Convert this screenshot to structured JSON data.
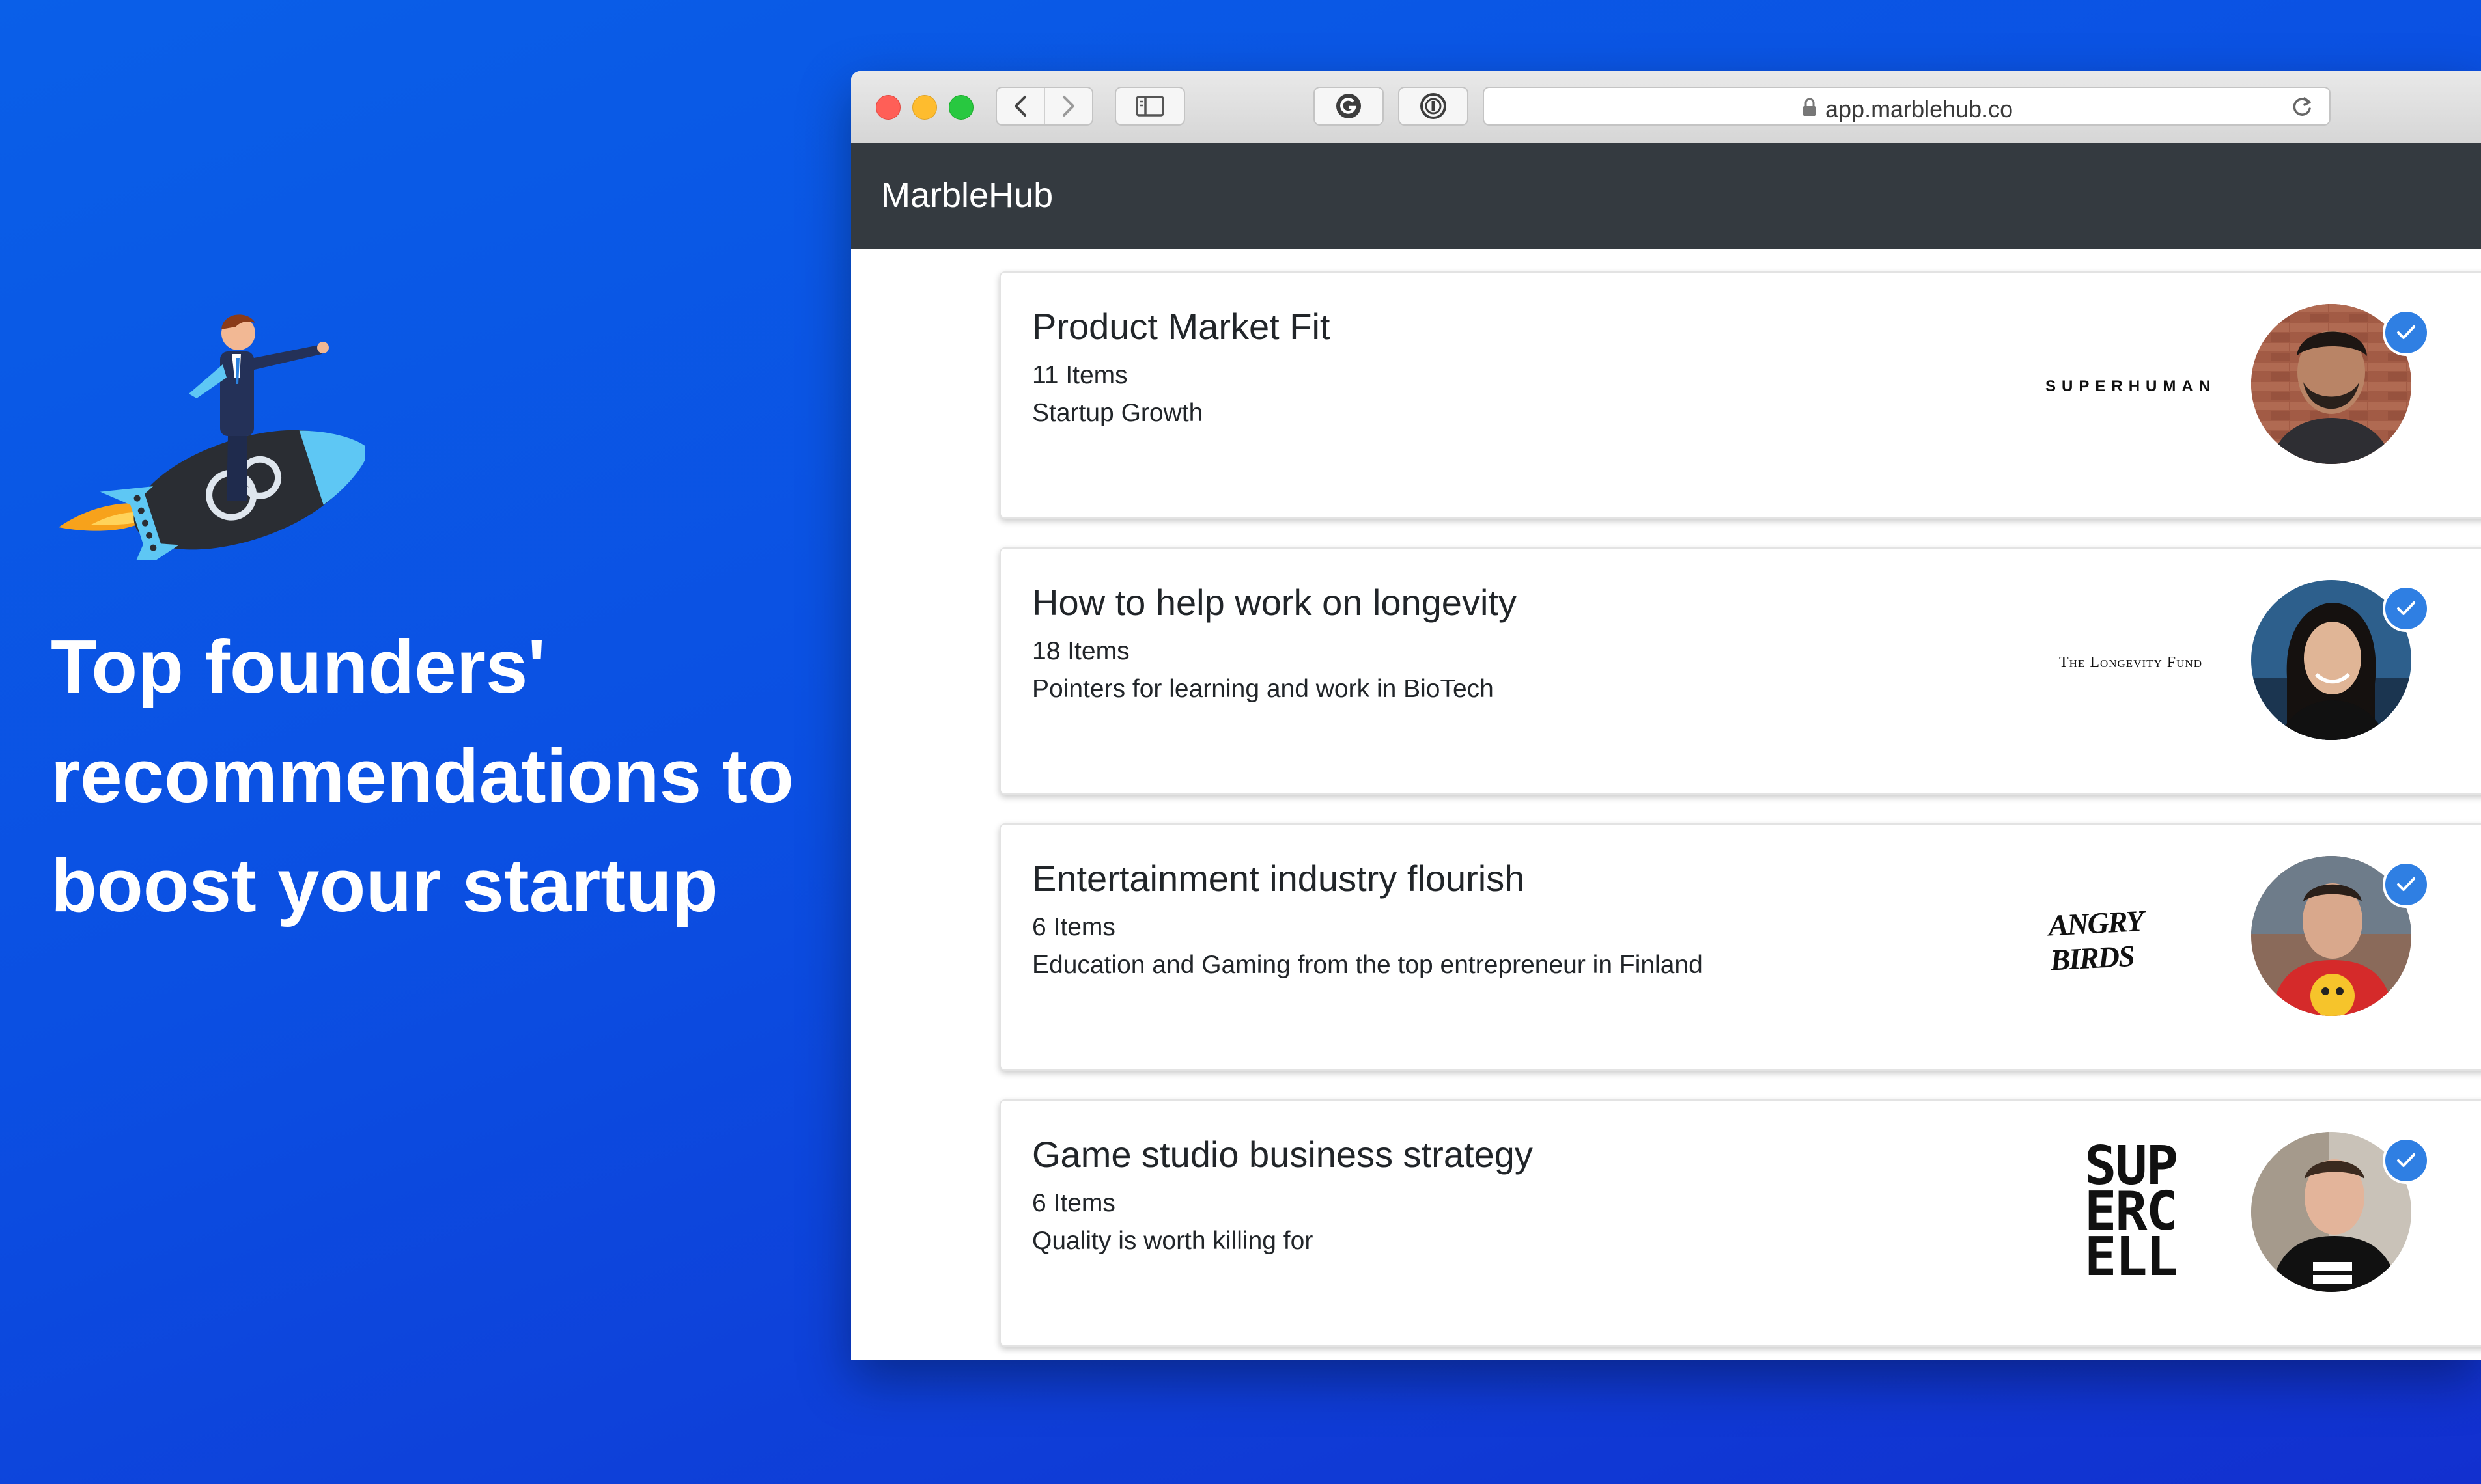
{
  "hero": {
    "headline_lines": [
      "Top founders'",
      "recommendations to",
      "boost your startup"
    ]
  },
  "browser": {
    "url": "app.marblehub.co",
    "icons": {
      "back": "chevron-left-icon",
      "forward": "chevron-right-icon",
      "sidebar": "sidebar-icon",
      "ext1": "grammarly-icon",
      "ext2": "password-manager-icon",
      "lock": "lock-icon",
      "reload": "reload-icon"
    }
  },
  "app": {
    "brand": "MarbleHub"
  },
  "collections": [
    {
      "title": "Product Market Fit",
      "items": "11 Items",
      "description": "Startup Growth",
      "company": "SUPERHUMAN",
      "verified": true
    },
    {
      "title": "How to help work on longevity",
      "items": "18 Items",
      "description": "Pointers for learning and work in BioTech",
      "company": "The Longevity Fund",
      "verified": true
    },
    {
      "title": "Entertainment industry flourish",
      "items": "6 Items",
      "description": "Education and Gaming from the top entrepreneur in Finland",
      "company": "ANGRY BIRDS",
      "verified": true
    },
    {
      "title": "Game studio business strategy",
      "items": "6 Items",
      "description": "Quality is worth killing for",
      "company": "SUPERCELL",
      "verified": true
    }
  ],
  "colors": {
    "background_gradient_start": "#0a5fe8",
    "background_gradient_end": "#1230cf",
    "app_header": "#343a40",
    "verified_badge": "#2f7fe3"
  }
}
